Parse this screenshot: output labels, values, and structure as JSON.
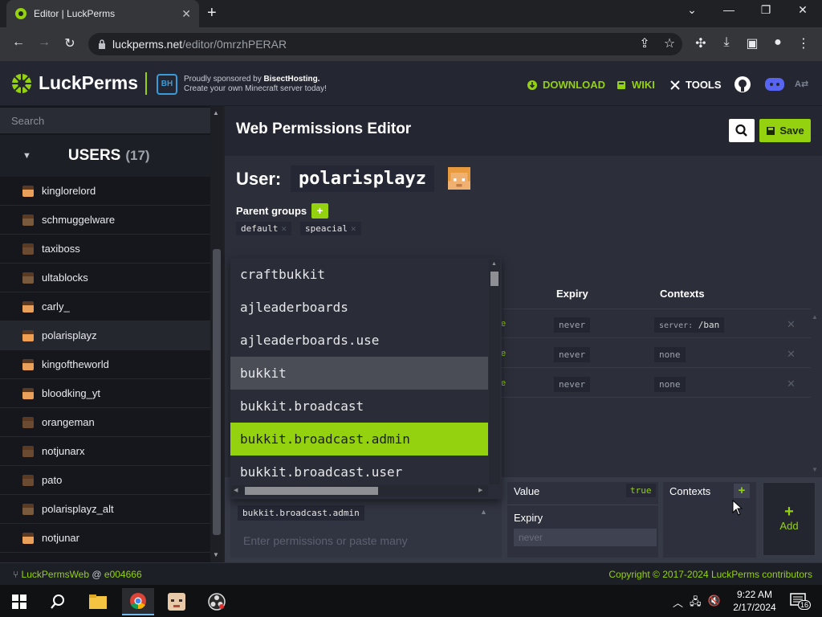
{
  "browser": {
    "tab_title": "Editor | LuckPerms",
    "url_host": "luckperms.net",
    "url_path": "/editor/0mrzhPERAR"
  },
  "header": {
    "brand": "LuckPerms",
    "sponsor_line1_prefix": "Proudly sponsored by ",
    "sponsor_name": "BisectHosting.",
    "sponsor_line2": "Create your own Minecraft server today!",
    "nav": {
      "download": "DOWNLOAD",
      "wiki": "WIKI",
      "tools": "TOOLS"
    }
  },
  "sidebar": {
    "search_placeholder": "Search",
    "section_label": "USERS",
    "section_count": "(17)",
    "users": [
      {
        "name": "kinglorelord",
        "skin": "#e8a05a",
        "selected": false
      },
      {
        "name": "schmuggelware",
        "skin": "#7a5a3c",
        "selected": false
      },
      {
        "name": "taxiboss",
        "skin": "#6b4a32",
        "selected": false
      },
      {
        "name": "ultablocks",
        "skin": "#7a5a3c",
        "selected": false
      },
      {
        "name": "carly_",
        "skin": "#e8a05a",
        "selected": false
      },
      {
        "name": "polarisplayz",
        "skin": "#f0a050",
        "selected": true
      },
      {
        "name": "kingoftheworld",
        "skin": "#e8a05a",
        "selected": false
      },
      {
        "name": "bloodking_yt",
        "skin": "#e8a05a",
        "selected": false
      },
      {
        "name": "orangeman",
        "skin": "#6b4a32",
        "selected": false
      },
      {
        "name": "notjunarx",
        "skin": "#6b4a32",
        "selected": false
      },
      {
        "name": "pato",
        "skin": "#6b4a32",
        "selected": false
      },
      {
        "name": "polarisplayz_alt",
        "skin": "#7a5a3c",
        "selected": false
      },
      {
        "name": "notjunar",
        "skin": "#e8a05a",
        "selected": false
      }
    ]
  },
  "main": {
    "title": "Web Permissions Editor",
    "save_label": "Save",
    "user_label": "User:",
    "username": "polarisplayz",
    "parent_groups_label": "Parent groups",
    "parent_groups": [
      "default",
      "speacial"
    ],
    "table_headers": {
      "value_fragment": "e",
      "expiry": "Expiry",
      "contexts": "Contexts"
    },
    "rows": [
      {
        "value_fragment": "e",
        "expiry": "never",
        "context_key": "server:",
        "context_value": "/ban"
      },
      {
        "value_fragment": "e",
        "expiry": "never",
        "context_value": "none"
      },
      {
        "value_fragment": "e",
        "expiry": "never",
        "context_value": "none"
      }
    ]
  },
  "dropdown": {
    "options": [
      "craftbukkit",
      "ajleaderboards",
      "ajleaderboards.use",
      "bukkit",
      "bukkit.broadcast",
      "bukkit.broadcast.admin",
      "bukkit.broadcast.user"
    ],
    "hovered_index": 3,
    "active_index": 5
  },
  "add_row": {
    "selected_permission": "bukkit.broadcast.admin",
    "permission_placeholder": "Enter permissions or paste many",
    "value_label": "Value",
    "value": "true",
    "expiry_label": "Expiry",
    "expiry_placeholder": "never",
    "contexts_label": "Contexts",
    "add_label": "Add"
  },
  "footer": {
    "repo": "LuckPermsWeb",
    "at": "@",
    "commit": "e004666",
    "copyright": "Copyright © 2017-2024 LuckPerms contributors"
  },
  "taskbar": {
    "time": "9:22 AM",
    "date": "2/17/2024",
    "notification_count": "16"
  },
  "colors": {
    "accent": "#94d20f",
    "background": "#2c2f3a",
    "sidebar": "#16171c"
  }
}
